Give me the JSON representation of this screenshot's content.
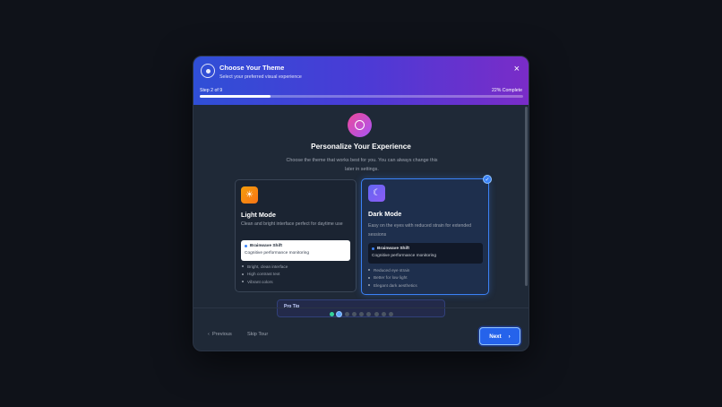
{
  "header": {
    "title": "Choose Your Theme",
    "subtitle": "Select your preferred visual experience",
    "close_icon": "×",
    "step_label": "Step 2 of 9",
    "percent_label": "22% Complete",
    "progress_fraction": 0.22
  },
  "hero": {
    "title": "Personalize Your Experience",
    "description": "Choose the theme that works best for you. You can always change this later in settings."
  },
  "options": {
    "light": {
      "title": "Light Mode",
      "description": "Clean and bright interface perfect for daytime use",
      "preview_title": "Brainwave Shift",
      "preview_sub": "Cognitive performance monitoring",
      "features": [
        "Bright, clean interface",
        "High contrast text",
        "Vibrant colors"
      ],
      "icon": "sun-icon"
    },
    "dark": {
      "title": "Dark Mode",
      "description": "Easy on the eyes with reduced strain for extended sessions",
      "preview_title": "Brainwave Shift",
      "preview_sub": "Cognitive performance monitoring",
      "features": [
        "Reduced eye strain",
        "Better for low light",
        "Elegant dark aesthetics"
      ],
      "icon": "moon-icon",
      "selected": true
    }
  },
  "pro_tip": {
    "label": "Pro Tip"
  },
  "steps": {
    "total": 9,
    "current": 2
  },
  "footer": {
    "previous_label": "Previous",
    "skip_label": "Skip Tour",
    "next_label": "Next"
  },
  "colors": {
    "accent": "#3b82f6",
    "header_gradient_start": "#2f4fd6",
    "header_gradient_end": "#7a2cc8",
    "step_done": "#34d399"
  }
}
